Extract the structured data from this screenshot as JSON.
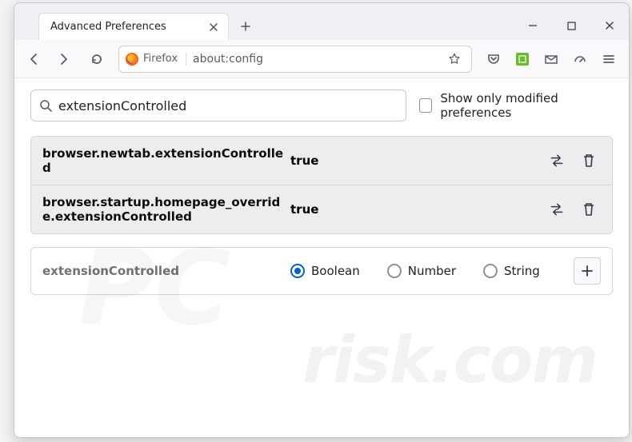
{
  "window": {
    "tab_title": "Advanced Preferences"
  },
  "toolbar": {
    "identity_label": "Firefox",
    "url": "about:config"
  },
  "search": {
    "value": "extensionControlled",
    "show_modified_label": "Show only modified preferences"
  },
  "prefs": [
    {
      "name": "browser.newtab.extensionControlled",
      "value": "true"
    },
    {
      "name": "browser.startup.homepage_override.extensionControlled",
      "value": "true"
    }
  ],
  "new_pref": {
    "name": "extensionControlled",
    "types": [
      "Boolean",
      "Number",
      "String"
    ],
    "selected": 0
  }
}
